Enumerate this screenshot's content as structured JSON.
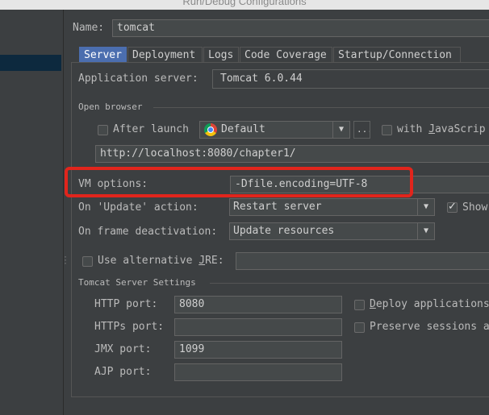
{
  "window": {
    "title": "Run/Debug Configurations"
  },
  "config": {
    "name_label": "Name:",
    "name_value": "tomcat"
  },
  "tabs": [
    {
      "label": "Server"
    },
    {
      "label": "Deployment"
    },
    {
      "label": "Logs"
    },
    {
      "label": "Code Coverage"
    },
    {
      "label": "Startup/Connection"
    }
  ],
  "server": {
    "app_server_label": "Application server:",
    "app_server_value": "Tomcat 6.0.44",
    "open_browser_label": "Open browser",
    "after_launch_label": "After launch",
    "after_launch_checked": false,
    "browser_value": "Default",
    "browser_more": "...",
    "with_javascript_label_pre": "with ",
    "with_javascript_label_mn": "J",
    "with_javascript_label_post": "avaScrip",
    "url_value": "http://localhost:8080/chapter1/",
    "vm_options_label": "VM options:",
    "vm_options_value": "-Dfile.encoding=UTF-8",
    "on_update_label": "On 'Update' action:",
    "on_update_value": "Restart server",
    "show_label": "Show",
    "show_checked": true,
    "on_frame_label": "On frame deactivation:",
    "on_frame_value": "Update resources",
    "use_alt_jre_pre": "Use alternative ",
    "use_alt_jre_mn": "J",
    "use_alt_jre_post": "RE:",
    "tomcat_settings_label": "Tomcat Server Settings",
    "http_port_label": "HTTP port:",
    "http_port_value": "8080",
    "https_port_label": "HTTPs port:",
    "https_port_value": "",
    "jmx_port_label": "JMX port:",
    "jmx_port_value": "1099",
    "ajp_port_label": "AJP port:",
    "ajp_port_value": "",
    "deploy_label_mn": "D",
    "deploy_label_post": "eploy applications",
    "preserve_label": "Preserve sessions a"
  },
  "colors": {
    "accent": "#4b6eaf",
    "highlight": "#e1251c",
    "background": "#3c3f41"
  },
  "icons": {
    "browser": "chrome-icon",
    "dropdown": "chevron-down-icon",
    "check": "check-icon"
  }
}
